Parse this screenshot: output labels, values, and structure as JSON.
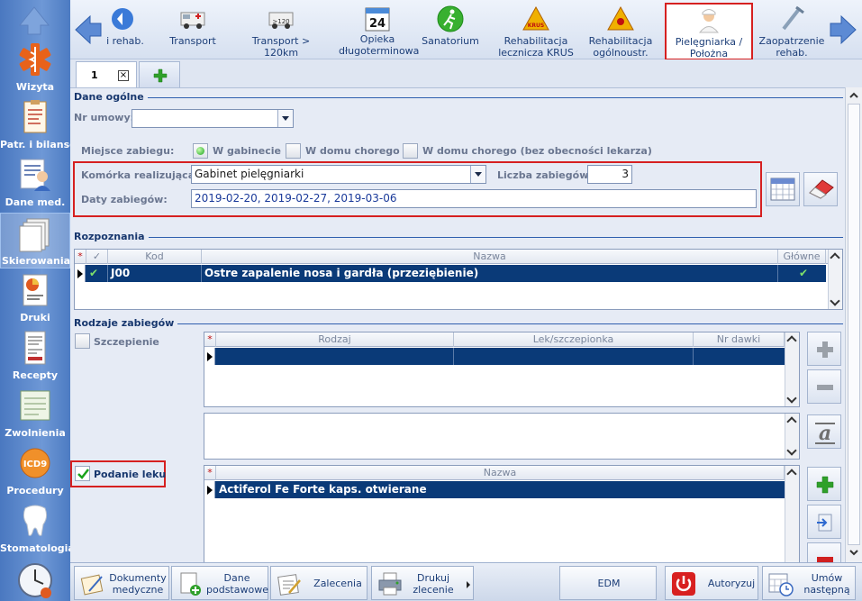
{
  "sidebar": {
    "items": [
      {
        "label": "Wizyta",
        "icon": "caduceus-star-icon"
      },
      {
        "label": "Patr. i bilanse",
        "icon": "clipboard-icon"
      },
      {
        "label": "Dane med.",
        "icon": "doctor-chart-icon"
      },
      {
        "label": "Skierowania",
        "icon": "documents-icon"
      },
      {
        "label": "Druki",
        "icon": "printout-icon"
      },
      {
        "label": "Recepty",
        "icon": "prescription-icon"
      },
      {
        "label": "Zwolnienia",
        "icon": "sick-leave-icon"
      },
      {
        "label": "Procedury",
        "icon": "icd9-icon"
      },
      {
        "label": "Stomatologia",
        "icon": "tooth-icon"
      }
    ]
  },
  "toolbar": {
    "items": [
      {
        "label": "i rehab.",
        "icon": "rehab-icon"
      },
      {
        "label": "Transport",
        "icon": "ambulance-icon"
      },
      {
        "label": "Transport > 120km",
        "icon": "ambulance-120-icon"
      },
      {
        "label": "Opieka",
        "label2": "długoterminowa",
        "icon": "calendar-24-icon",
        "cal_num": "24"
      },
      {
        "label": "Sanatorium",
        "icon": "runner-icon"
      },
      {
        "label": "Rehabilitacja",
        "label2": "lecznicza KRUS",
        "icon": "krus-warning-icon",
        "badge": "KRUS"
      },
      {
        "label": "Rehabilitacja",
        "label2": "ogólnoustr.",
        "icon": "warning-icon"
      },
      {
        "label": "Pielęgniarka /",
        "label2": "Położna",
        "icon": "nurse-icon"
      },
      {
        "label": "Zaopatrzenie",
        "label2": "rehab.",
        "icon": "crutch-icon"
      }
    ]
  },
  "tabs": {
    "tab1": "1",
    "close": "×"
  },
  "general": {
    "title": "Dane ogólne",
    "contract_label": "Nr umowy:",
    "contract_value": "",
    "place_label": "Miejsce zabiegu:",
    "place_options": [
      "W gabinecie",
      "W domu chorego",
      "W domu chorego (bez obecności lekarza)"
    ],
    "unit_label": "Komórka realizująca:",
    "unit_value": "Gabinet pielęgniarki",
    "count_label": "Liczba zabiegów:",
    "count_value": "3",
    "dates_label": "Daty zabiegów:",
    "dates_value": "2019-02-20, 2019-02-27, 2019-03-06"
  },
  "diagnosis": {
    "title": "Rozpoznania",
    "columns": [
      "Kod",
      "Nazwa",
      "Główne"
    ],
    "rows": [
      {
        "code": "J00",
        "name": "Ostre zapalenie nosa i gardła (przeziębienie)"
      }
    ]
  },
  "treatments": {
    "title": "Rodzaje zabiegów",
    "vaccination_label": "Szczepienie",
    "vaccination_columns": [
      "Rodzaj",
      "Lek/szczepionka",
      "Nr dawki"
    ],
    "drug_label": "Podanie leku",
    "drug_columns": [
      "Nazwa"
    ],
    "drug_rows": [
      {
        "name": "Actiferol Fe Forte kaps. otwierane"
      }
    ]
  },
  "bottom": {
    "docs": [
      "Dokumenty",
      "medyczne"
    ],
    "base": [
      "Dane",
      "podstawowe"
    ],
    "recs": "Zalecenia",
    "print": [
      "Drukuj",
      "zlecenie"
    ],
    "edm": "EDM",
    "auth": "Autoryzuj",
    "next": [
      "Umów",
      "następną"
    ]
  },
  "colors": {
    "accent": "#0a3a78",
    "highlight": "#d62020",
    "check": "#19a21b"
  }
}
